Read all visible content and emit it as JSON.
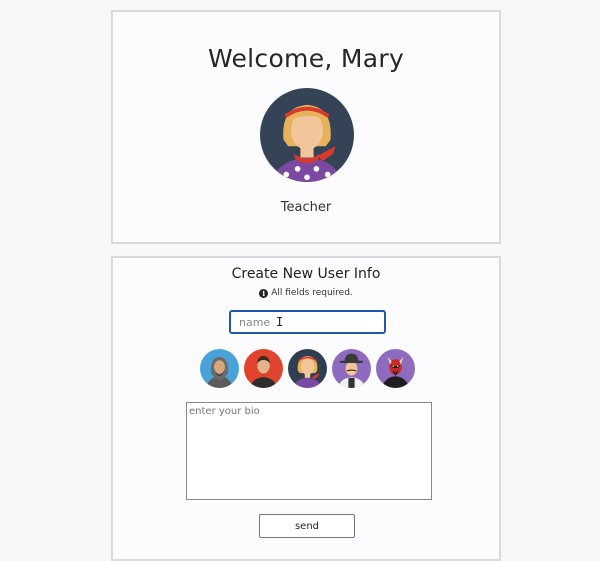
{
  "welcome": {
    "title": "Welcome, Mary",
    "avatar_icon": "teacher-avatar-icon",
    "role": "Teacher"
  },
  "form": {
    "title": "Create New User Info",
    "required_note": "All fields required.",
    "info_icon": "info-icon",
    "name_placeholder": "name",
    "avatars": [
      {
        "icon": "bearded-man-avatar-icon",
        "bg": "#4aa3d8"
      },
      {
        "icon": "hipster-man-avatar-icon",
        "bg": "#e0442e"
      },
      {
        "icon": "teacher-avatar-icon",
        "bg": "#2f3e50"
      },
      {
        "icon": "gentleman-hat-avatar-icon",
        "bg": "#8e6bbf"
      },
      {
        "icon": "darth-maul-avatar-icon",
        "bg": "#8e6bbf"
      }
    ],
    "bio_placeholder": "enter your bio",
    "send_label": "send"
  },
  "colors": {
    "accent": "#1d5ba8",
    "card_border": "#d9d9de",
    "page_bg": "#f7f7fa"
  }
}
